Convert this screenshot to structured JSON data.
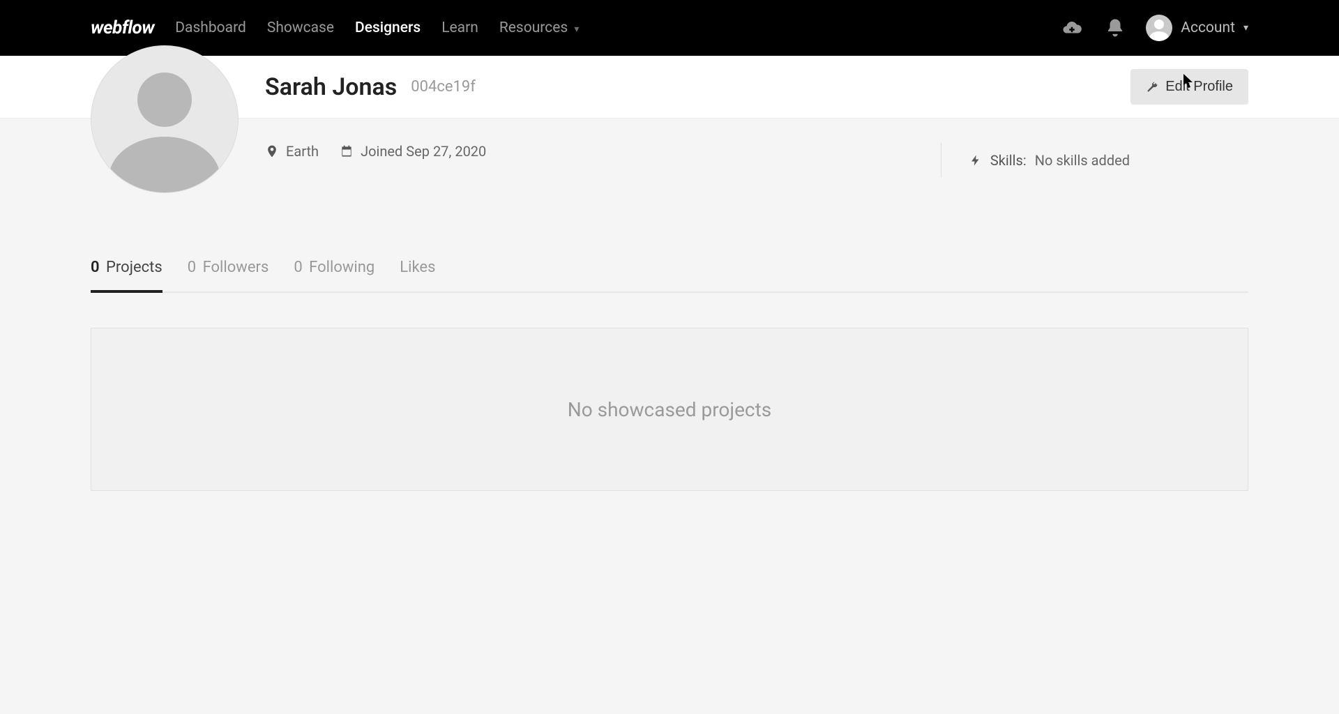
{
  "nav": {
    "logo": "webflow",
    "links": [
      {
        "label": "Dashboard",
        "active": false
      },
      {
        "label": "Showcase",
        "active": false
      },
      {
        "label": "Designers",
        "active": true
      },
      {
        "label": "Learn",
        "active": false
      },
      {
        "label": "Resources",
        "active": false,
        "hasCaret": true
      }
    ],
    "account_label": "Account"
  },
  "profile": {
    "name": "Sarah Jonas",
    "id": "004ce19f",
    "edit_label": "Edit Profile",
    "location": "Earth",
    "joined": "Joined Sep 27, 2020",
    "skills_label": "Skills:",
    "skills_value": "No skills added"
  },
  "tabs": {
    "projects": {
      "count": "0",
      "label": "Projects"
    },
    "followers": {
      "count": "0",
      "label": "Followers"
    },
    "following": {
      "count": "0",
      "label": "Following"
    },
    "likes": {
      "label": "Likes"
    }
  },
  "empty_state": "No showcased projects"
}
